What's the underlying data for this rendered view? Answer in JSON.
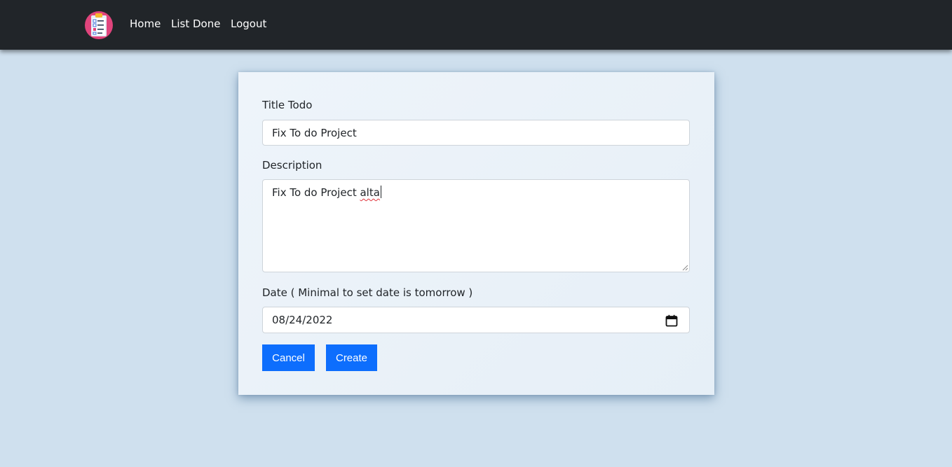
{
  "navbar": {
    "logo_name": "todo-clipboard-logo",
    "links": [
      {
        "label": "Home"
      },
      {
        "label": "List Done"
      },
      {
        "label": "Logout"
      }
    ]
  },
  "form": {
    "title": {
      "label": "Title Todo",
      "value": "Fix To do Project"
    },
    "description": {
      "label": "Description",
      "value_main": "Fix To do Project ",
      "value_misspelled": "alta"
    },
    "date": {
      "label": "Date ( Minimal to set date is tomorrow )",
      "value": "08/24/2022",
      "icon": "calendar-icon"
    },
    "buttons": {
      "cancel": "Cancel",
      "create": "Create"
    }
  },
  "colors": {
    "navbar_bg": "#212529",
    "page_bg": "#cfe0ee",
    "primary": "#0d6efd",
    "logo_bg": "#e0447c"
  }
}
